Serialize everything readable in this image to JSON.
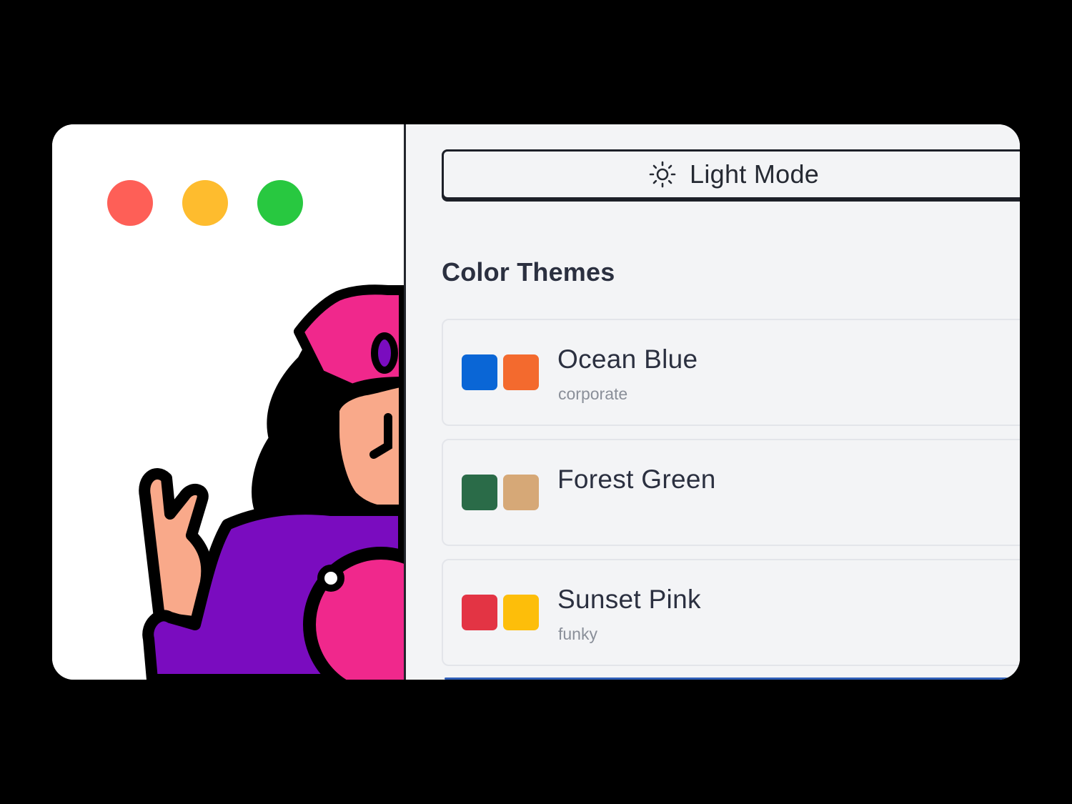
{
  "window": {
    "traffic_lights": [
      {
        "name": "close",
        "color": "#fe5f57"
      },
      {
        "name": "minimize",
        "color": "#febc2e"
      },
      {
        "name": "zoom",
        "color": "#28c840"
      }
    ]
  },
  "illustration": {
    "icon": "mascot-illustration",
    "colors": {
      "outline": "#000000",
      "hat": "#f0288c",
      "skin": "#f9a98a",
      "shirt": "#7a0cbf",
      "ball": "#f0288c",
      "gem": "#7a0cbf"
    }
  },
  "sidebar": {
    "mode_button": {
      "label": "Light Mode",
      "icon": "sun-icon"
    },
    "section_title": "Color Themes",
    "themes": [
      {
        "name": "Ocean Blue",
        "tag": "corporate",
        "colors": [
          "#0a66d6",
          "#f36a2e"
        ]
      },
      {
        "name": "Forest Green",
        "tag": "",
        "colors": [
          "#2a6b48",
          "#d6a877"
        ]
      },
      {
        "name": "Sunset Pink",
        "tag": "funky",
        "colors": [
          "#e33444",
          "#fdbe0a"
        ]
      }
    ]
  }
}
